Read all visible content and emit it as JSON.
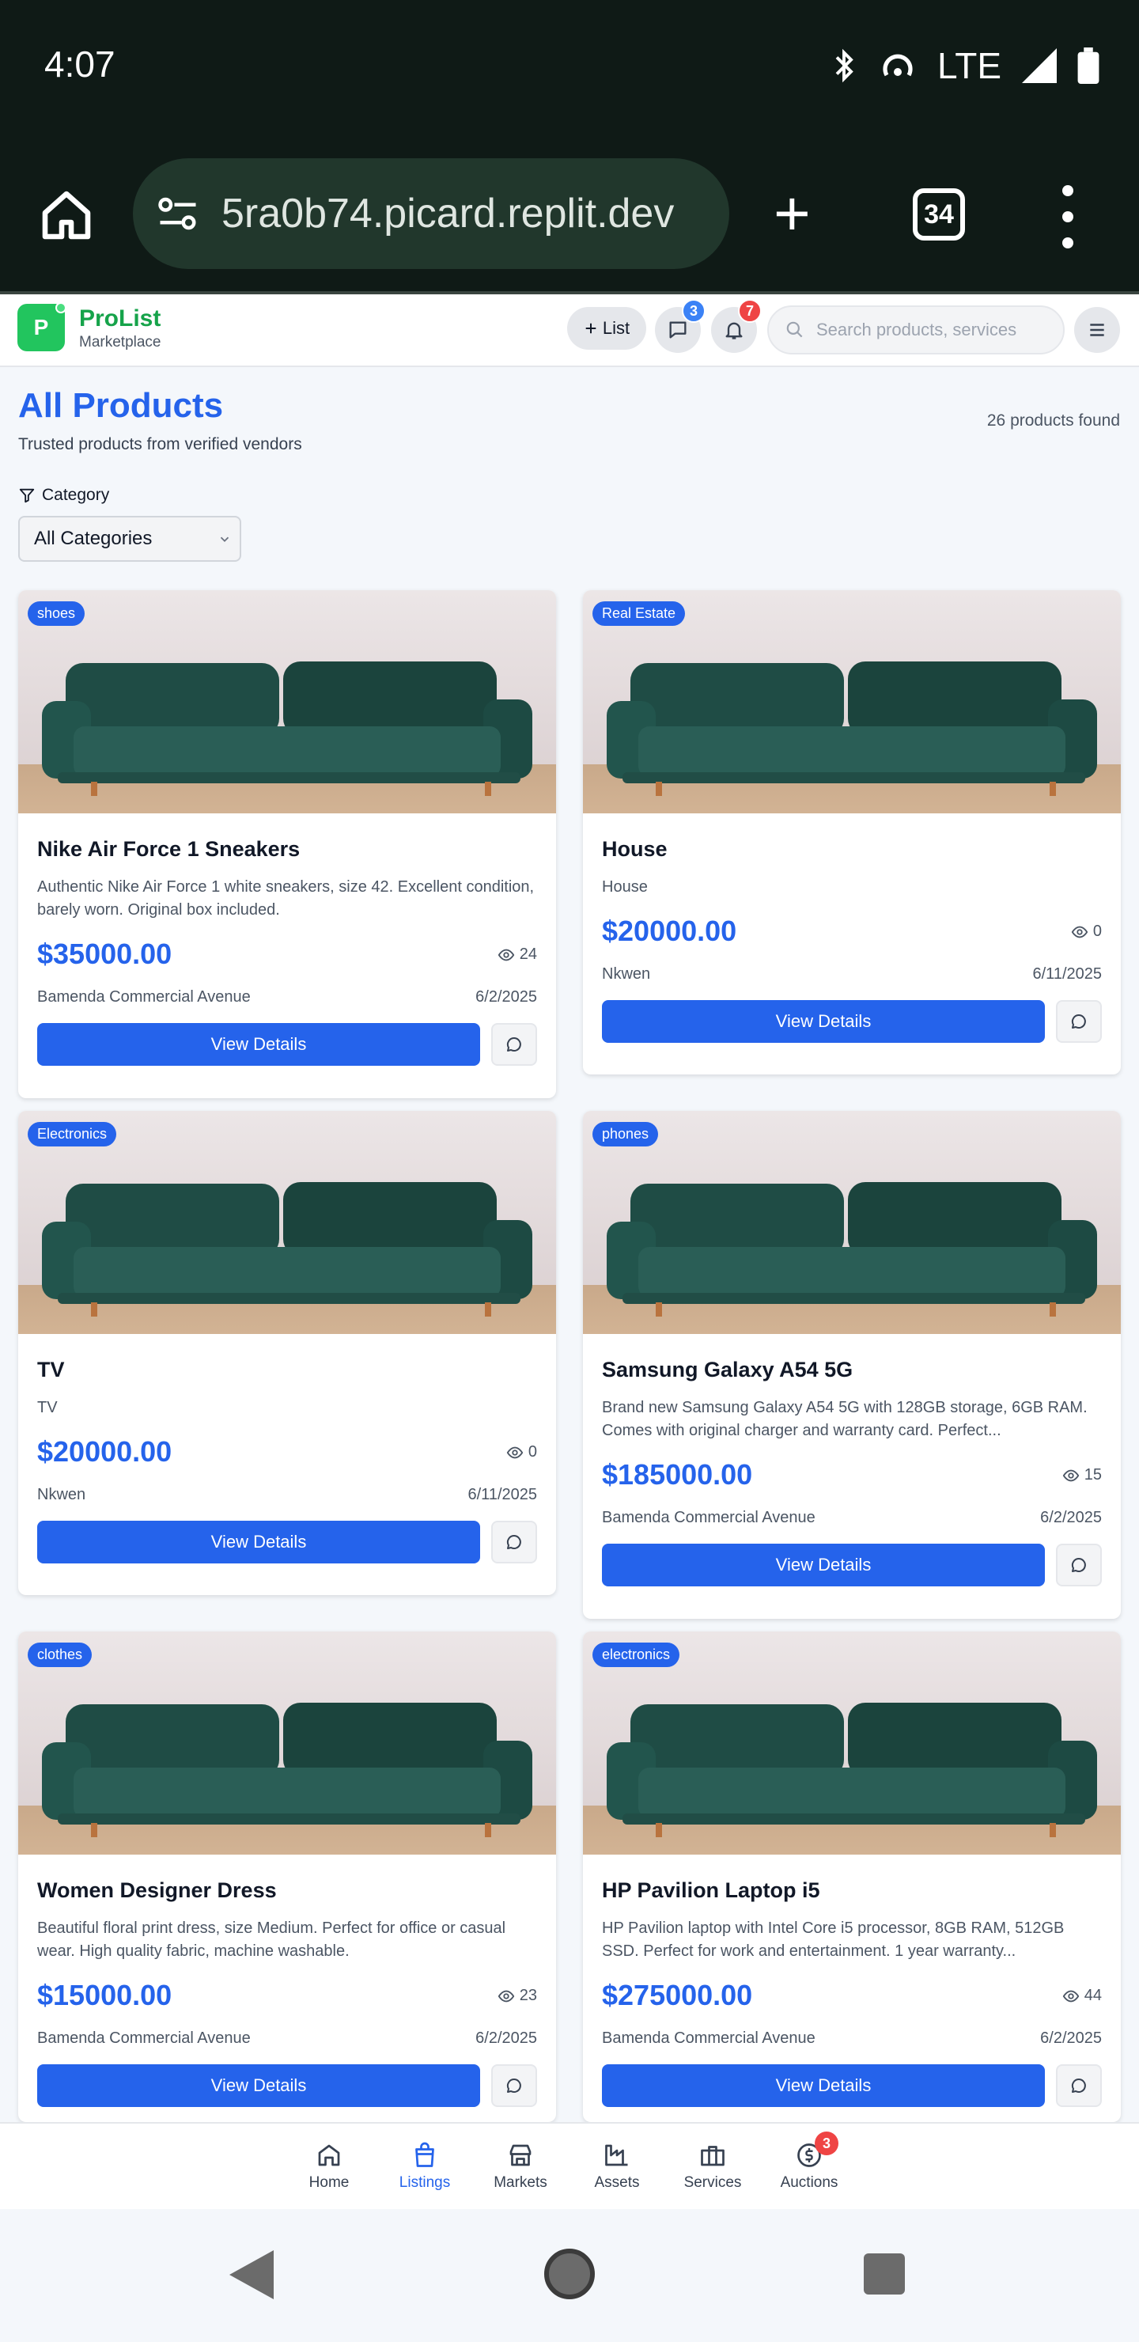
{
  "status_bar": {
    "time": "4:07",
    "network": "LTE"
  },
  "browser": {
    "url": "5ra0b74.picard.replit.dev",
    "tab_count": "34"
  },
  "header": {
    "logo_letter": "P",
    "brand": "ProList",
    "brand_sub": "Marketplace",
    "list_button": "List",
    "messages_badge": "3",
    "notifications_badge": "7",
    "search_placeholder": "Search products, services"
  },
  "page": {
    "title": "All Products",
    "subtitle": "Trusted products from verified vendors",
    "count_text": "26 products found",
    "category_label": "Category",
    "category_selected": "All Categories"
  },
  "products": [
    {
      "tag": "shoes",
      "title": "Nike Air Force 1 Sneakers",
      "desc": "Authentic Nike Air Force 1 white sneakers, size 42. Excellent condition, barely worn. Original box included.",
      "price": "$35000.00",
      "views": "24",
      "location": "Bamenda Commercial Avenue",
      "date": "6/2/2025",
      "button": "View Details"
    },
    {
      "tag": "Real Estate",
      "title": "House",
      "desc": "House",
      "price": "$20000.00",
      "views": "0",
      "location": "Nkwen",
      "date": "6/11/2025",
      "button": "View Details"
    },
    {
      "tag": "Electronics",
      "title": "TV",
      "desc": "TV",
      "price": "$20000.00",
      "views": "0",
      "location": "Nkwen",
      "date": "6/11/2025",
      "button": "View Details"
    },
    {
      "tag": "phones",
      "title": "Samsung Galaxy A54 5G",
      "desc": "Brand new Samsung Galaxy A54 5G with 128GB storage, 6GB RAM. Comes with original charger and warranty card. Perfect...",
      "price": "$185000.00",
      "views": "15",
      "location": "Bamenda Commercial Avenue",
      "date": "6/2/2025",
      "button": "View Details"
    },
    {
      "tag": "clothes",
      "title": "Women Designer Dress",
      "desc": "Beautiful floral print dress, size Medium. Perfect for office or casual wear. High quality fabric, machine washable.",
      "price": "$15000.00",
      "views": "23",
      "location": "Bamenda Commercial Avenue",
      "date": "6/2/2025",
      "button": "View Details"
    },
    {
      "tag": "electronics",
      "title": "HP Pavilion Laptop i5",
      "desc": "HP Pavilion laptop with Intel Core i5 processor, 8GB RAM, 512GB SSD. Perfect for work and entertainment. 1 year warranty...",
      "price": "$275000.00",
      "views": "44",
      "location": "Bamenda Commercial Avenue",
      "date": "6/2/2025",
      "button": "View Details"
    }
  ],
  "bottom_nav": [
    {
      "label": "Home",
      "icon": "home-icon"
    },
    {
      "label": "Listings",
      "icon": "shopping-bag-icon",
      "active": true
    },
    {
      "label": "Markets",
      "icon": "store-icon"
    },
    {
      "label": "Assets",
      "icon": "factory-icon"
    },
    {
      "label": "Services",
      "icon": "briefcase-icon"
    },
    {
      "label": "Auctions",
      "icon": "dollar-icon",
      "badge": "3"
    }
  ],
  "colors": {
    "primary": "#2563eb",
    "brand_green": "#16a34a",
    "badge_red": "#ef4444",
    "status_bar": "#0f1a16"
  }
}
